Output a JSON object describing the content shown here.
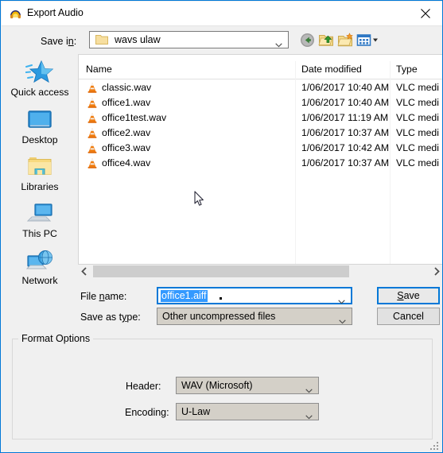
{
  "window": {
    "title": "Export Audio",
    "icon": "headphones-icon",
    "close_label": "✕",
    "accent_color": "#0078d7"
  },
  "toolbar": {
    "save_in_label": "Save in:",
    "save_in_label_pre": "Save i",
    "save_in_label_accel": "n",
    "save_in_label_post": ":",
    "current_folder": "wavs ulaw",
    "buttons": [
      {
        "name": "back-button",
        "tooltip": "Back"
      },
      {
        "name": "up-one-level-button",
        "tooltip": "Up One Level"
      },
      {
        "name": "create-new-folder-button",
        "tooltip": "Create New Folder"
      },
      {
        "name": "views-button",
        "tooltip": "Views"
      }
    ]
  },
  "places": {
    "items": [
      {
        "label": "Quick access",
        "icon": "star-icon"
      },
      {
        "label": "Desktop",
        "icon": "monitor-icon"
      },
      {
        "label": "Libraries",
        "icon": "folder-icon"
      },
      {
        "label": "This PC",
        "icon": "computer-icon"
      },
      {
        "label": "Network",
        "icon": "network-globe-icon"
      }
    ]
  },
  "file_list": {
    "sort_column": "Name",
    "sort_direction": "ascending",
    "columns": [
      "Name",
      "Date modified",
      "Type"
    ],
    "rows": [
      {
        "name": "classic.wav",
        "date": "1/06/2017 10:40 AM",
        "type": "VLC medi",
        "icon": "vlc-cone-icon"
      },
      {
        "name": "office1.wav",
        "date": "1/06/2017 10:40 AM",
        "type": "VLC medi",
        "icon": "vlc-cone-icon"
      },
      {
        "name": "office1test.wav",
        "date": "1/06/2017 11:19 AM",
        "type": "VLC medi",
        "icon": "vlc-cone-icon"
      },
      {
        "name": "office2.wav",
        "date": "1/06/2017 10:37 AM",
        "type": "VLC medi",
        "icon": "vlc-cone-icon"
      },
      {
        "name": "office3.wav",
        "date": "1/06/2017 10:42 AM",
        "type": "VLC medi",
        "icon": "vlc-cone-icon"
      },
      {
        "name": "office4.wav",
        "date": "1/06/2017 10:37 AM",
        "type": "VLC medi",
        "icon": "vlc-cone-icon"
      }
    ]
  },
  "form": {
    "file_name_label_pre": "File ",
    "file_name_label_accel": "n",
    "file_name_label_post": "ame:",
    "file_name_value": "office1.aiff",
    "file_name_selected": true,
    "save_as_type_label_pre": "Save as t",
    "save_as_type_label_accel": "y",
    "save_as_type_label_post": "pe:",
    "save_as_type_value": "Other uncompressed files",
    "save_button_pre": "",
    "save_button_accel": "S",
    "save_button_post": "ave",
    "cancel_button_label": "Cancel"
  },
  "format_options": {
    "group_title": "Format Options",
    "header_label": "Header:",
    "header_value": "WAV (Microsoft)",
    "encoding_label": "Encoding:",
    "encoding_value": "U-Law"
  }
}
